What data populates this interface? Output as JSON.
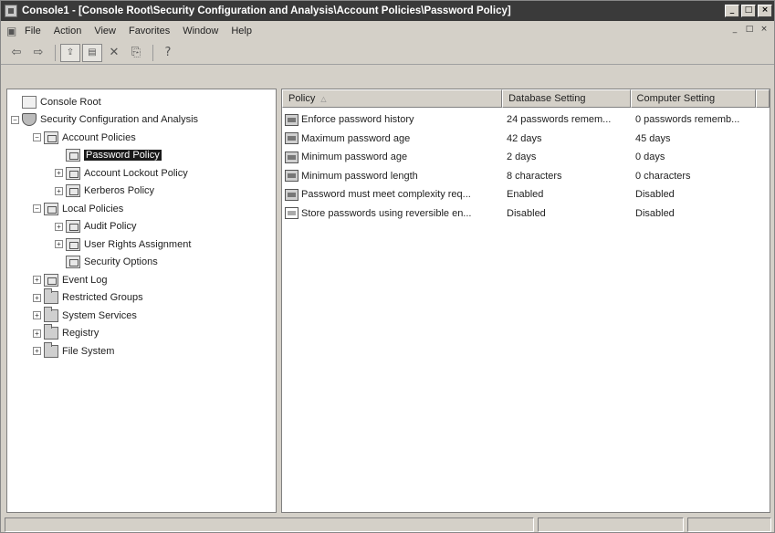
{
  "window": {
    "title": "Console1 - [Console Root\\Security Configuration and Analysis\\Account Policies\\Password Policy]",
    "controls": [
      "_",
      "□",
      "×"
    ]
  },
  "menu": {
    "items": [
      "File",
      "Action",
      "View",
      "Favorites",
      "Window",
      "Help"
    ],
    "mdi_controls": [
      "_",
      "□",
      "×"
    ]
  },
  "toolbar": {
    "icons": [
      "back-icon",
      "forward-icon",
      "up-level-icon",
      "show-hide-tree-icon",
      "delete-icon",
      "export-list-icon",
      "help-icon"
    ]
  },
  "tree": {
    "items": [
      {
        "label": "Console Root",
        "level": 0,
        "expander": "",
        "icon": "console-icon"
      },
      {
        "label": "Security Configuration and Analysis",
        "level": 0,
        "expander": "−",
        "icon": "security-config-icon"
      },
      {
        "label": "Account Policies",
        "level": 1,
        "expander": "−",
        "icon": "policy-folder-icon"
      },
      {
        "label": "Password Policy",
        "level": 2,
        "expander": "",
        "icon": "policy-folder-icon",
        "selected": true
      },
      {
        "label": "Account Lockout Policy",
        "level": 2,
        "expander": "+",
        "icon": "policy-folder-icon"
      },
      {
        "label": "Kerberos Policy",
        "level": 2,
        "expander": "+",
        "icon": "policy-folder-icon"
      },
      {
        "label": "Local Policies",
        "level": 1,
        "expander": "−",
        "icon": "policy-folder-icon"
      },
      {
        "label": "Audit Policy",
        "level": 2,
        "expander": "+",
        "icon": "policy-folder-icon"
      },
      {
        "label": "User Rights Assignment",
        "level": 2,
        "expander": "+",
        "icon": "policy-folder-icon"
      },
      {
        "label": "Security Options",
        "level": 2,
        "expander": "",
        "icon": "policy-folder-icon"
      },
      {
        "label": "Event Log",
        "level": 1,
        "expander": "+",
        "icon": "policy-folder-icon"
      },
      {
        "label": "Restricted Groups",
        "level": 1,
        "expander": "+",
        "icon": "folder-icon"
      },
      {
        "label": "System Services",
        "level": 1,
        "expander": "+",
        "icon": "folder-icon"
      },
      {
        "label": "Registry",
        "level": 1,
        "expander": "+",
        "icon": "folder-icon"
      },
      {
        "label": "File System",
        "level": 1,
        "expander": "+",
        "icon": "folder-icon"
      }
    ]
  },
  "list": {
    "columns": [
      "Policy",
      "Database Setting",
      "Computer Setting"
    ],
    "sort_indicator": "△",
    "rows": [
      {
        "policy": "Enforce password history",
        "database": "24 passwords remem...",
        "computer": "0 passwords rememb..."
      },
      {
        "policy": "Maximum password age",
        "database": "42 days",
        "computer": "45 days"
      },
      {
        "policy": "Minimum password age",
        "database": "2 days",
        "computer": "0 days"
      },
      {
        "policy": "Minimum password length",
        "database": "8 characters",
        "computer": "0 characters"
      },
      {
        "policy": "Password must meet complexity req...",
        "database": "Enabled",
        "computer": "Disabled"
      },
      {
        "policy": "Store passwords using reversible en...",
        "database": "Disabled",
        "computer": "Disabled"
      }
    ]
  }
}
